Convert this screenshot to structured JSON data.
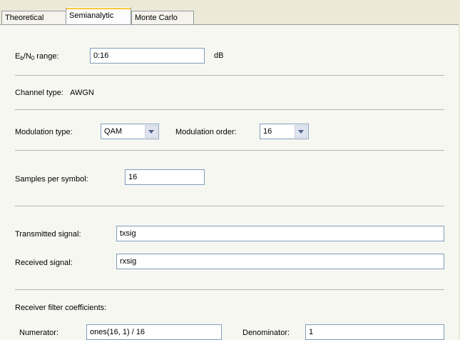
{
  "tabs": [
    "Theoretical",
    "Semianalytic",
    "Monte Carlo"
  ],
  "ebno": {
    "label_main": "E",
    "label_sub1": "b",
    "label_slash": "/N",
    "label_sub2": "0",
    "label_rest": " range:",
    "value": "0:16",
    "unit": "dB"
  },
  "channel": {
    "label": "Channel type:",
    "value": "AWGN"
  },
  "modulation": {
    "type_label": "Modulation type:",
    "type_value": "QAM",
    "order_label": "Modulation order:",
    "order_value": "16"
  },
  "samples": {
    "label": "Samples per symbol:",
    "value": "16"
  },
  "signals": {
    "tx_label": "Transmitted signal:",
    "tx_value": "txsig",
    "rx_label": "Received signal:",
    "rx_value": "rxsig"
  },
  "filter": {
    "title": "Receiver filter coefficients:",
    "num_label": "Numerator:",
    "num_value": "ones(16, 1) / 16",
    "den_label": "Denominator:",
    "den_value": "1"
  }
}
